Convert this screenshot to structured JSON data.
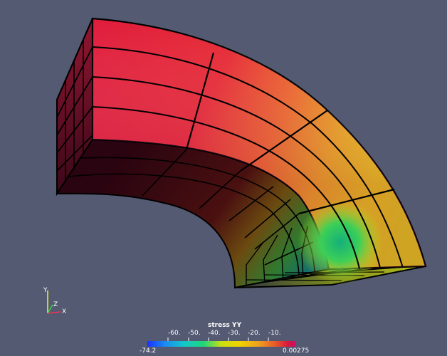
{
  "scalar_bar": {
    "title": "stress YY",
    "min_label": "-74.2",
    "max_label": "0.00275",
    "tick_labels": [
      "-60.",
      "-50.",
      "-40.",
      "-30.",
      "-20.",
      "-10."
    ],
    "colors": [
      "#1b32ff",
      "#14b7e8",
      "#1fd67a",
      "#c9e012",
      "#f0d400",
      "#f0a020",
      "#e8552b",
      "#d8183d",
      "#c80e6a"
    ]
  },
  "orientation_axes": {
    "x_label": "X",
    "y_label": "Y",
    "z_label": "Z",
    "colors": {
      "x": "#ff2d55",
      "y": "#f2f23a",
      "z": "#32d25a"
    }
  },
  "background_color": "#535a71"
}
